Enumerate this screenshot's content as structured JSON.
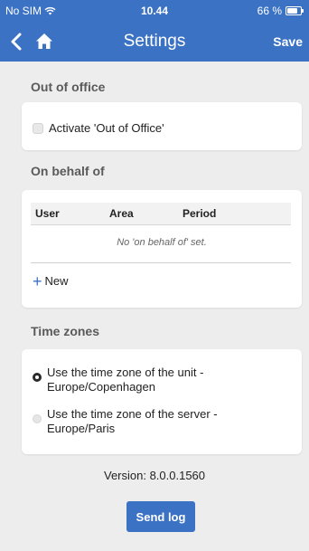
{
  "status_bar": {
    "carrier": "No SIM",
    "time": "10.44",
    "battery": "66 %"
  },
  "nav": {
    "title": "Settings",
    "save_label": "Save"
  },
  "out_of_office": {
    "section_label": "Out of office",
    "checkbox_label": "Activate 'Out of Office'",
    "checked": false
  },
  "on_behalf_of": {
    "section_label": "On behalf of",
    "columns": [
      "User",
      "Area",
      "Period"
    ],
    "empty_message": "No 'on behalf of' set.",
    "new_label": "New"
  },
  "time_zones": {
    "section_label": "Time zones",
    "options": [
      {
        "line1": "Use the time zone of the unit -",
        "line2": "Europe/Copenhagen",
        "selected": true
      },
      {
        "line1": "Use the time zone of the server -",
        "line2": "Europe/Paris",
        "selected": false
      }
    ]
  },
  "footer": {
    "version": "Version: 8.0.0.1560",
    "send_log_label": "Send log"
  },
  "colors": {
    "accent": "#3b72c4",
    "background": "#ededed"
  }
}
